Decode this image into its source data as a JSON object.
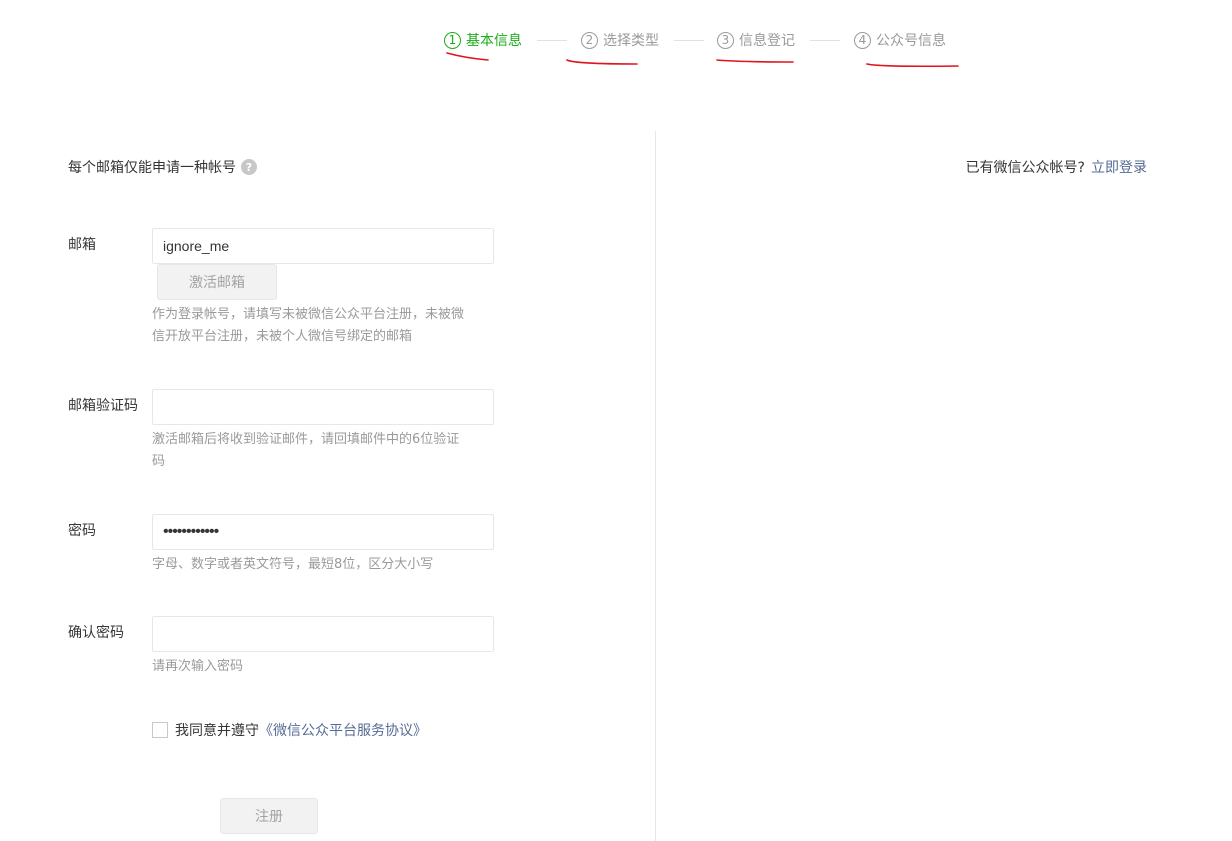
{
  "steps": [
    {
      "num": "1",
      "label": "基本信息",
      "active": true
    },
    {
      "num": "2",
      "label": "选择类型",
      "active": false
    },
    {
      "num": "3",
      "label": "信息登记",
      "active": false
    },
    {
      "num": "4",
      "label": "公众号信息",
      "active": false
    }
  ],
  "header": {
    "tip": "每个邮箱仅能申请一种帐号",
    "help_icon": "question-icon",
    "login_hint": "已有微信公众帐号?",
    "login_link": "立即登录"
  },
  "form": {
    "email": {
      "label": "邮箱",
      "value": "ignore_me",
      "activate_button": "激活邮箱",
      "desc": "作为登录帐号，请填写未被微信公众平台注册，未被微信开放平台注册，未被个人微信号绑定的邮箱"
    },
    "code": {
      "label": "邮箱验证码",
      "value": "",
      "desc": "激活邮箱后将收到验证邮件，请回填邮件中的6位验证码"
    },
    "password": {
      "label": "密码",
      "value": "••••••••••••",
      "desc": "字母、数字或者英文符号，最短8位，区分大小写"
    },
    "confirm": {
      "label": "确认密码",
      "value": "",
      "desc": "请再次输入密码"
    },
    "agree_text": "我同意并遵守",
    "agree_link": "《微信公众平台服务协议》",
    "agree_checked": false,
    "register_button": "注册"
  },
  "colors": {
    "active_step": "#1aad19",
    "link": "#576b95",
    "annotation": "#e0141e"
  }
}
